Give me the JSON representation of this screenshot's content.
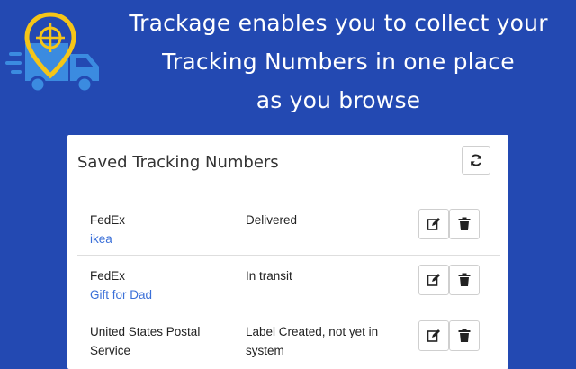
{
  "header": {
    "line1": "Trackage enables you to collect your",
    "line2": "Tracking Numbers in one place",
    "line3": "as you browse"
  },
  "panel": {
    "title": "Saved Tracking Numbers",
    "refresh_icon": "refresh-icon",
    "rows": [
      {
        "carrier": "FedEx",
        "label": "ikea",
        "status": "Delivered"
      },
      {
        "carrier": "FedEx",
        "label": "Gift for Dad",
        "status": "In transit"
      },
      {
        "carrier": "United States Postal Service",
        "label": "",
        "status": "Label Created, not yet in system"
      }
    ]
  },
  "colors": {
    "background": "#2349b2",
    "logo_pin": "#f5c518",
    "truck": "#3b8be0",
    "link": "#3a6fd8"
  }
}
